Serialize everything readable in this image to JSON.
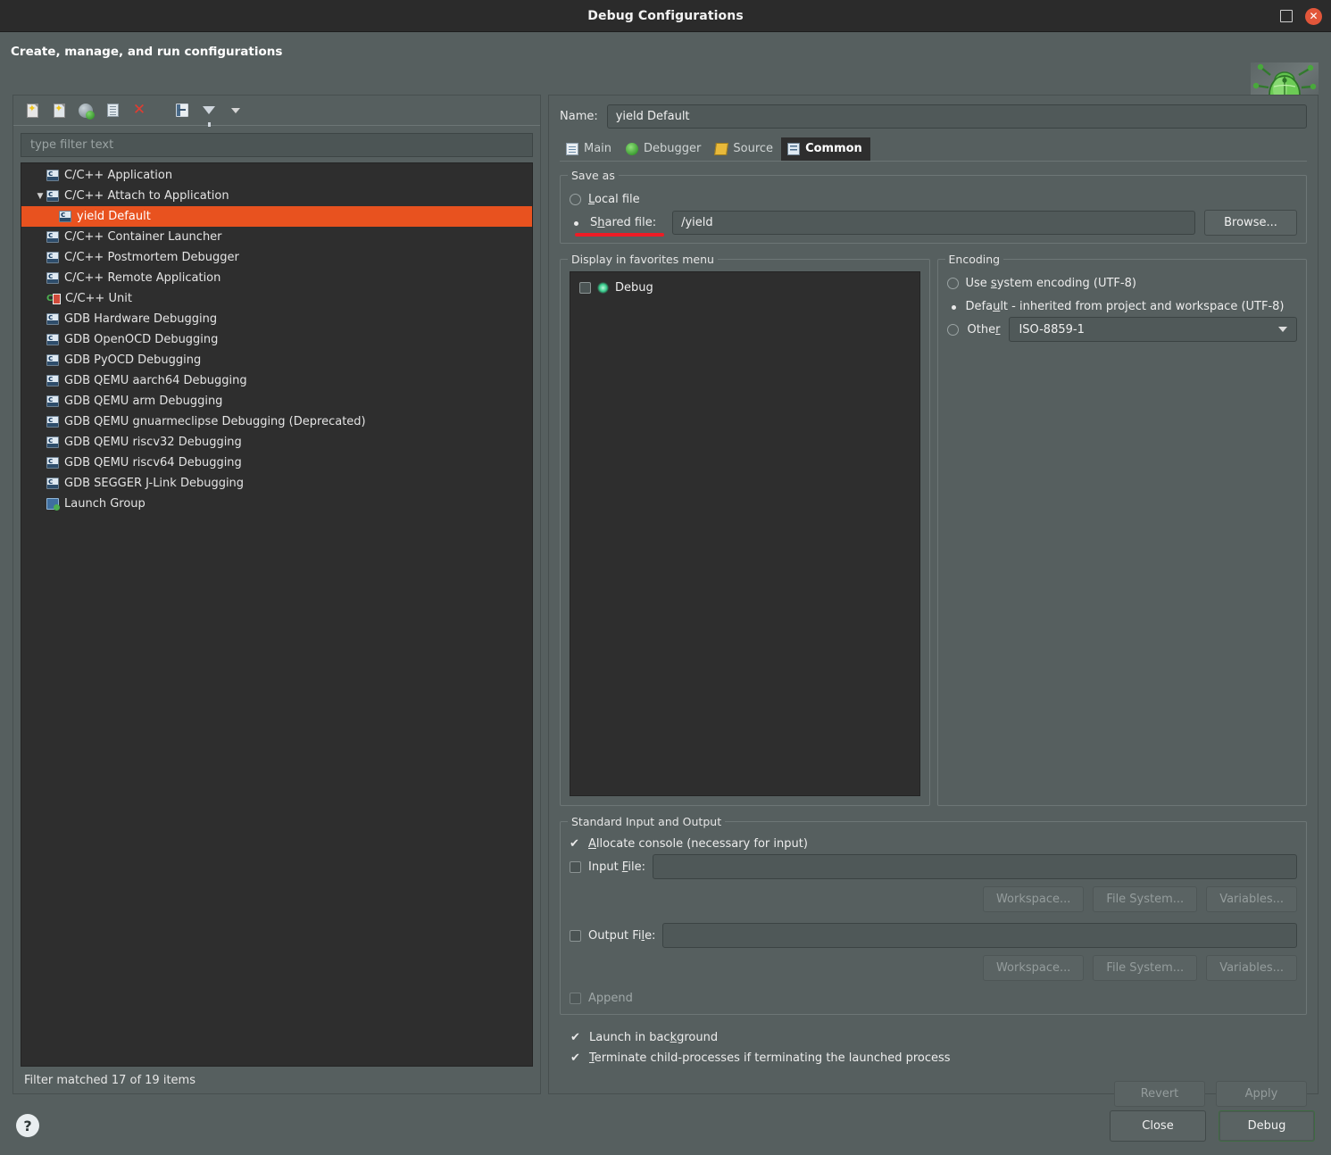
{
  "window": {
    "title": "Debug Configurations",
    "maximize_icon": "maximize-icon",
    "close_icon": "close-icon"
  },
  "header": {
    "title": "Create, manage, and run configurations",
    "badge_icon": "green-bug-icon"
  },
  "left_panel": {
    "toolbar": [
      {
        "name": "new-configuration",
        "icon": "new-document-icon"
      },
      {
        "name": "new-prototype",
        "icon": "new-prototype-icon"
      },
      {
        "name": "export",
        "icon": "globe-export-icon"
      },
      {
        "name": "duplicate",
        "icon": "duplicate-icon"
      },
      {
        "name": "delete",
        "icon": "red-x-delete-icon"
      },
      {
        "name": "collapse-all",
        "icon": "collapse-all-icon"
      },
      {
        "name": "filter",
        "icon": "filter-funnel-icon"
      },
      {
        "name": "view-menu",
        "icon": "chevron-down-icon"
      }
    ],
    "filter": {
      "placeholder": "type filter text",
      "value": ""
    },
    "tree": [
      {
        "label": "C/C++ Application",
        "icon": "c-launch-icon",
        "level": 0,
        "expandable": false,
        "selected": false
      },
      {
        "label": "C/C++ Attach to Application",
        "icon": "c-launch-icon",
        "level": 0,
        "expandable": true,
        "expanded": true,
        "selected": false
      },
      {
        "label": "yield Default",
        "icon": "c-launch-icon",
        "level": 1,
        "expandable": false,
        "selected": true
      },
      {
        "label": "C/C++ Container Launcher",
        "icon": "c-launch-icon",
        "level": 0,
        "expandable": false,
        "selected": false
      },
      {
        "label": "C/C++ Postmortem Debugger",
        "icon": "c-launch-icon",
        "level": 0,
        "expandable": false,
        "selected": false
      },
      {
        "label": "C/C++ Remote Application",
        "icon": "c-launch-icon",
        "level": 0,
        "expandable": false,
        "selected": false
      },
      {
        "label": "C/C++ Unit",
        "icon": "cpp-unit-icon",
        "level": 0,
        "expandable": false,
        "selected": false
      },
      {
        "label": "GDB Hardware Debugging",
        "icon": "c-launch-icon",
        "level": 0,
        "expandable": false,
        "selected": false
      },
      {
        "label": "GDB OpenOCD Debugging",
        "icon": "c-launch-icon",
        "level": 0,
        "expandable": false,
        "selected": false
      },
      {
        "label": "GDB PyOCD Debugging",
        "icon": "c-launch-icon",
        "level": 0,
        "expandable": false,
        "selected": false
      },
      {
        "label": "GDB QEMU aarch64 Debugging",
        "icon": "c-launch-icon",
        "level": 0,
        "expandable": false,
        "selected": false
      },
      {
        "label": "GDB QEMU arm Debugging",
        "icon": "c-launch-icon",
        "level": 0,
        "expandable": false,
        "selected": false
      },
      {
        "label": "GDB QEMU gnuarmeclipse Debugging (Deprecated)",
        "icon": "c-launch-icon",
        "level": 0,
        "expandable": false,
        "selected": false
      },
      {
        "label": "GDB QEMU riscv32 Debugging",
        "icon": "c-launch-icon",
        "level": 0,
        "expandable": false,
        "selected": false
      },
      {
        "label": "GDB QEMU riscv64 Debugging",
        "icon": "c-launch-icon",
        "level": 0,
        "expandable": false,
        "selected": false
      },
      {
        "label": "GDB SEGGER J-Link Debugging",
        "icon": "c-launch-icon",
        "level": 0,
        "expandable": false,
        "selected": false
      },
      {
        "label": "Launch Group",
        "icon": "launch-group-icon",
        "level": 0,
        "expandable": false,
        "selected": false
      }
    ],
    "status": "Filter matched 17 of 19 items"
  },
  "right_panel": {
    "name_label": "Name:",
    "name_value": "yield Default",
    "tabs": [
      {
        "label": "Main",
        "icon": "document-icon",
        "active": false
      },
      {
        "label": "Debugger",
        "icon": "bug-icon",
        "active": false
      },
      {
        "label": "Source",
        "icon": "source-pencil-icon",
        "active": false
      },
      {
        "label": "Common",
        "icon": "common-grid-icon",
        "active": true
      }
    ],
    "save_as": {
      "legend": "Save as",
      "local_file": {
        "label": "Local file",
        "selected": false
      },
      "shared_file": {
        "label": "Shared file:",
        "selected": true,
        "value": "/yield"
      },
      "browse_label": "Browse..."
    },
    "favorites": {
      "legend": "Display in favorites menu",
      "items": [
        {
          "label": "Debug",
          "checked": false,
          "icon": "debug-spark-icon"
        }
      ]
    },
    "encoding": {
      "legend": "Encoding",
      "options": [
        {
          "label": "Use system encoding (UTF-8)",
          "selected": false
        },
        {
          "label": "Default - inherited from project and workspace (UTF-8)",
          "selected": true
        },
        {
          "label": "Other",
          "selected": false
        }
      ],
      "other_value": "ISO-8859-1"
    },
    "std_io": {
      "legend": "Standard Input and Output",
      "allocate_console": {
        "label": "Allocate console (necessary for input)",
        "checked": true
      },
      "input_file": {
        "label": "Input File:",
        "checked": false,
        "value": ""
      },
      "output_file": {
        "label": "Output File:",
        "checked": false,
        "value": ""
      },
      "append": {
        "label": "Append",
        "checked": false,
        "enabled": false
      },
      "buttons": [
        "Workspace...",
        "File System...",
        "Variables..."
      ]
    },
    "launch_background": {
      "label": "Launch in background",
      "checked": true
    },
    "terminate_children": {
      "label": "Terminate child-processes if terminating the launched process",
      "checked": true
    },
    "revert_label": "Revert",
    "apply_label": "Apply"
  },
  "bottom_bar": {
    "help_icon": "help-question-icon",
    "close_label": "Close",
    "debug_label": "Debug"
  },
  "annotation": {
    "type": "red-underline",
    "target": "shared-file-radio-label"
  },
  "colors": {
    "selection": "#e8521f",
    "annotation": "#ee1c25",
    "window_bg": "#565f5f",
    "tree_bg": "#2e2e2e",
    "titlebar_bg": "#2b2b2b"
  }
}
